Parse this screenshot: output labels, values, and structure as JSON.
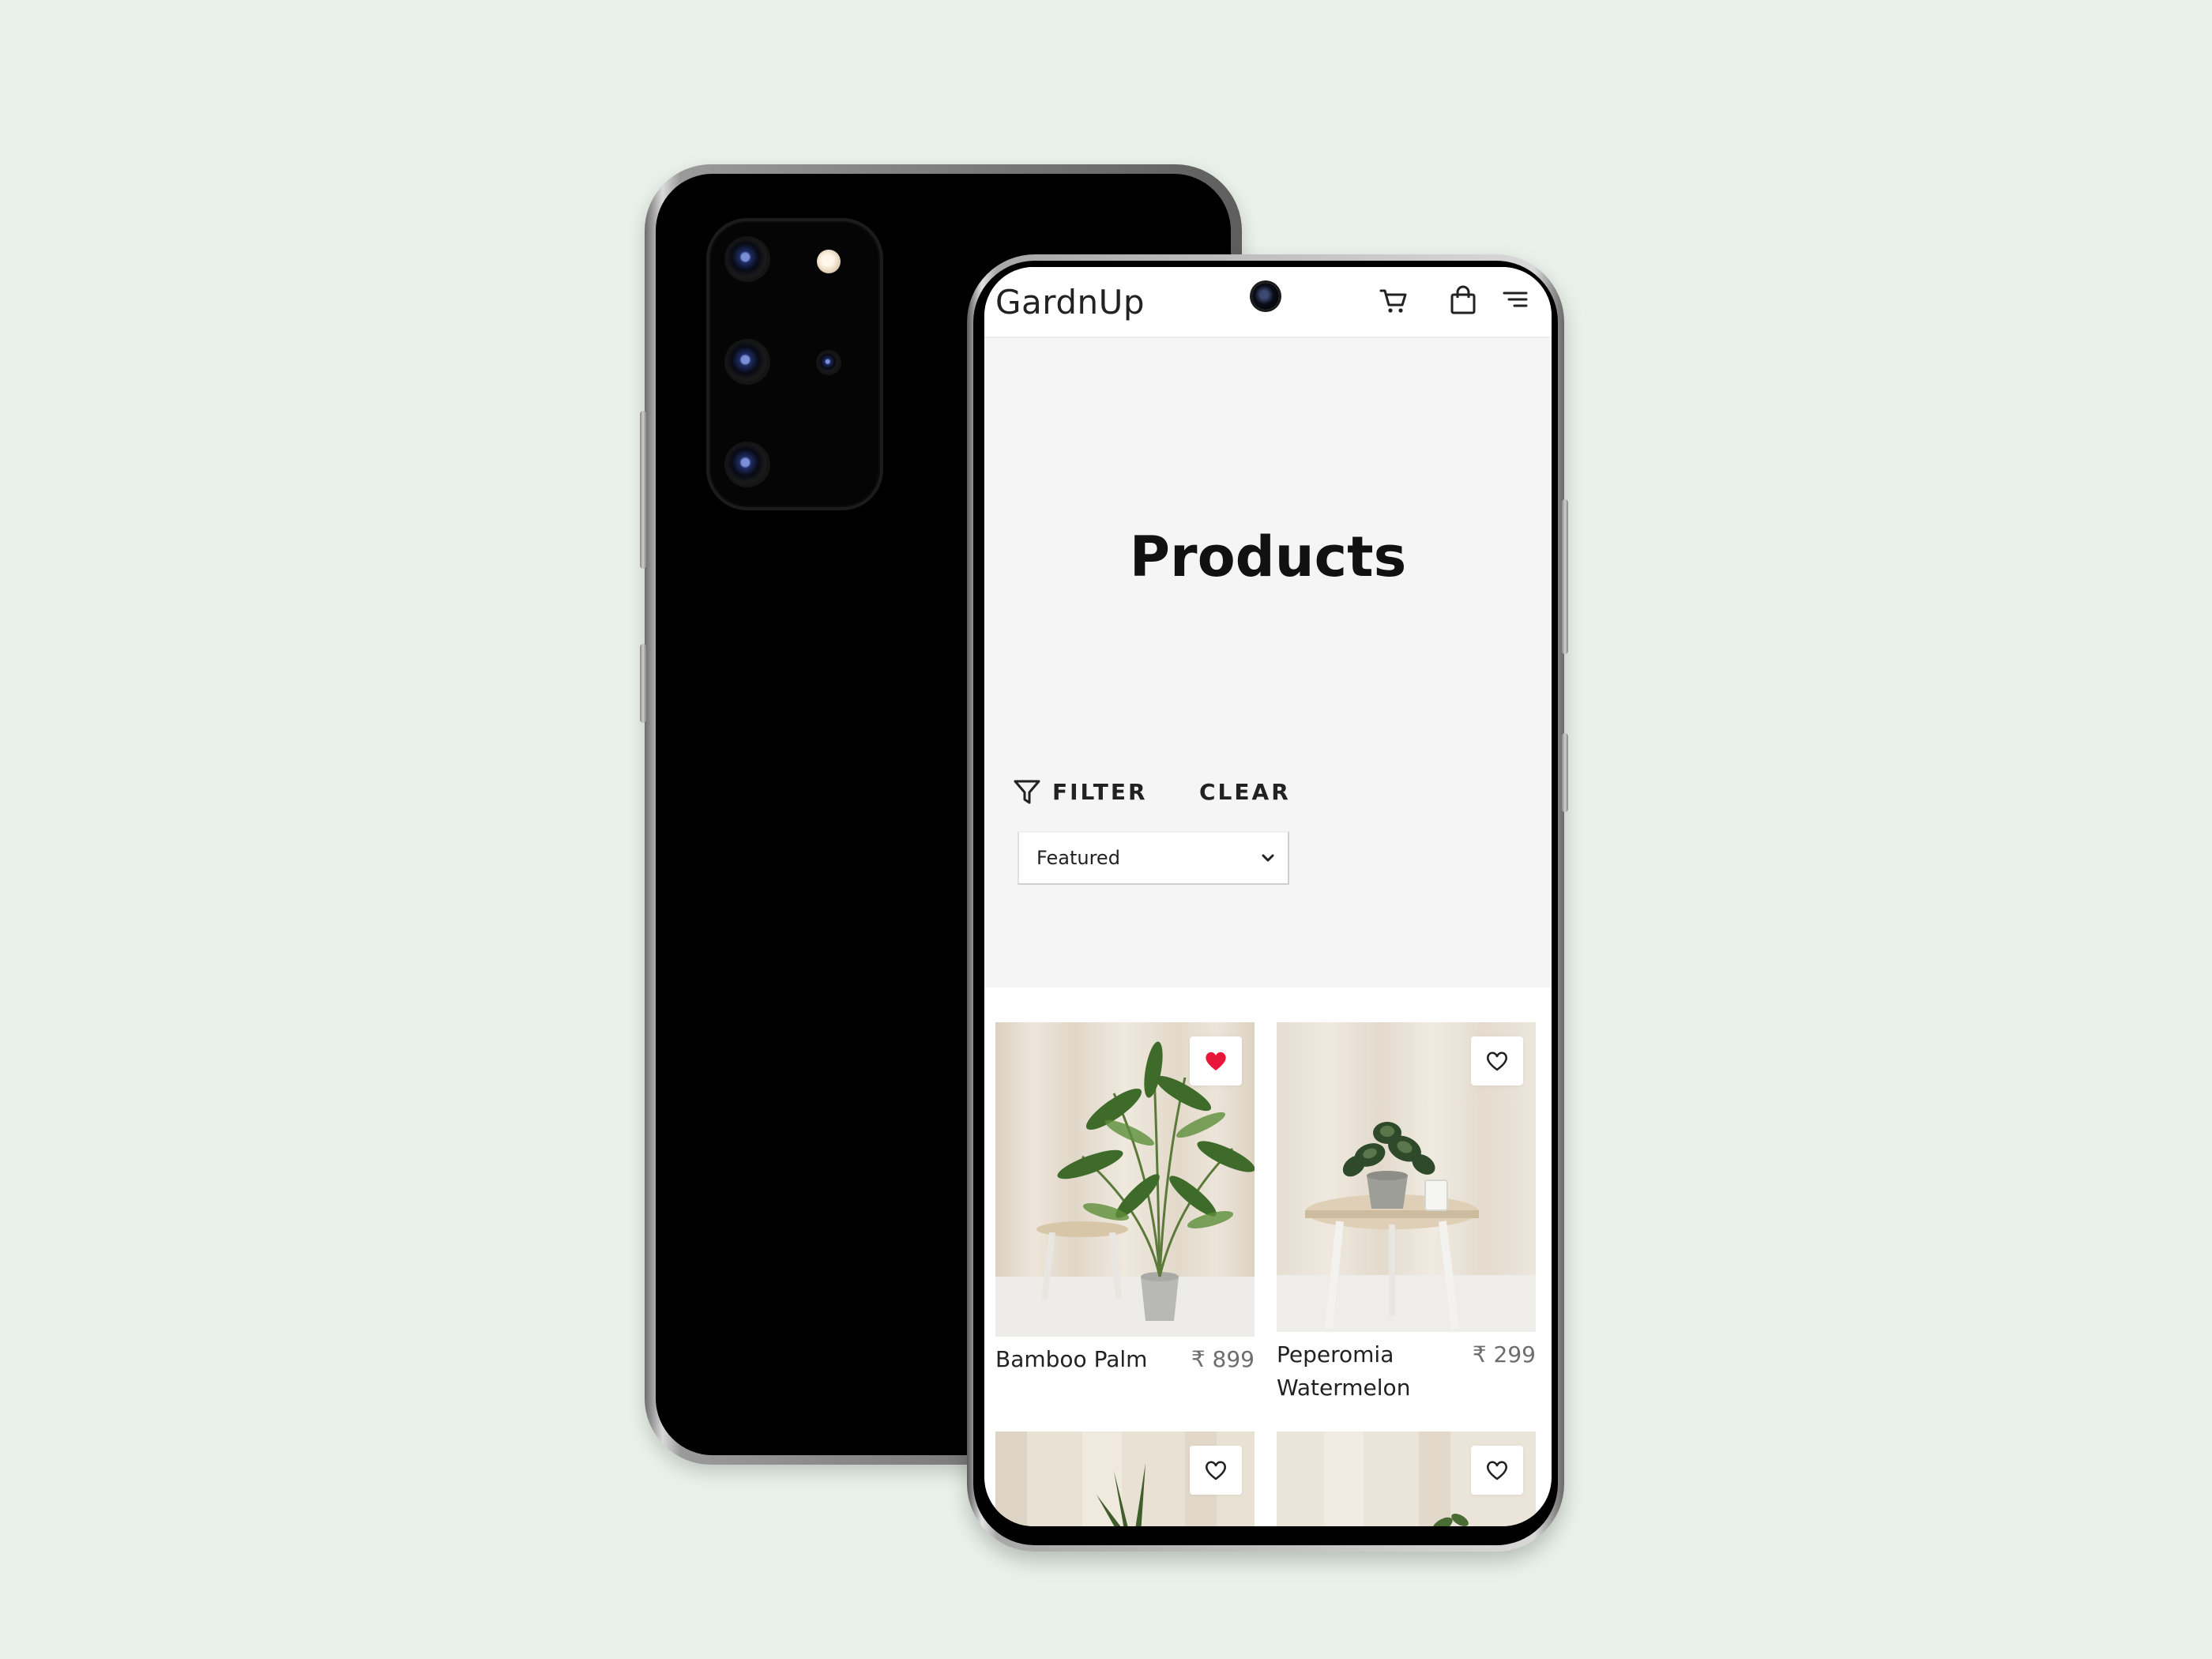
{
  "app": {
    "logo": "GardnUp",
    "header_icons": [
      "cart-icon",
      "shopping-bag-icon",
      "menu-icon"
    ]
  },
  "hero": {
    "title": "Products"
  },
  "toolbar": {
    "filter_label": "FILTER",
    "clear_label": "CLEAR",
    "sort_selected": "Featured"
  },
  "products": [
    {
      "name": "Bamboo Palm",
      "price": "₹ 899",
      "wishlisted": true
    },
    {
      "name": "Peperomia\nWatermelon",
      "price": "₹ 299",
      "wishlisted": false
    },
    {
      "name": "",
      "price": "",
      "wishlisted": false
    },
    {
      "name": "",
      "price": "",
      "wishlisted": false
    }
  ],
  "colors": {
    "background": "#eaf1ea",
    "hero_background": "#f5f5f5",
    "wishlist_active": "#e8173a",
    "text": "#222222",
    "price_text": "#6d6d6d"
  }
}
